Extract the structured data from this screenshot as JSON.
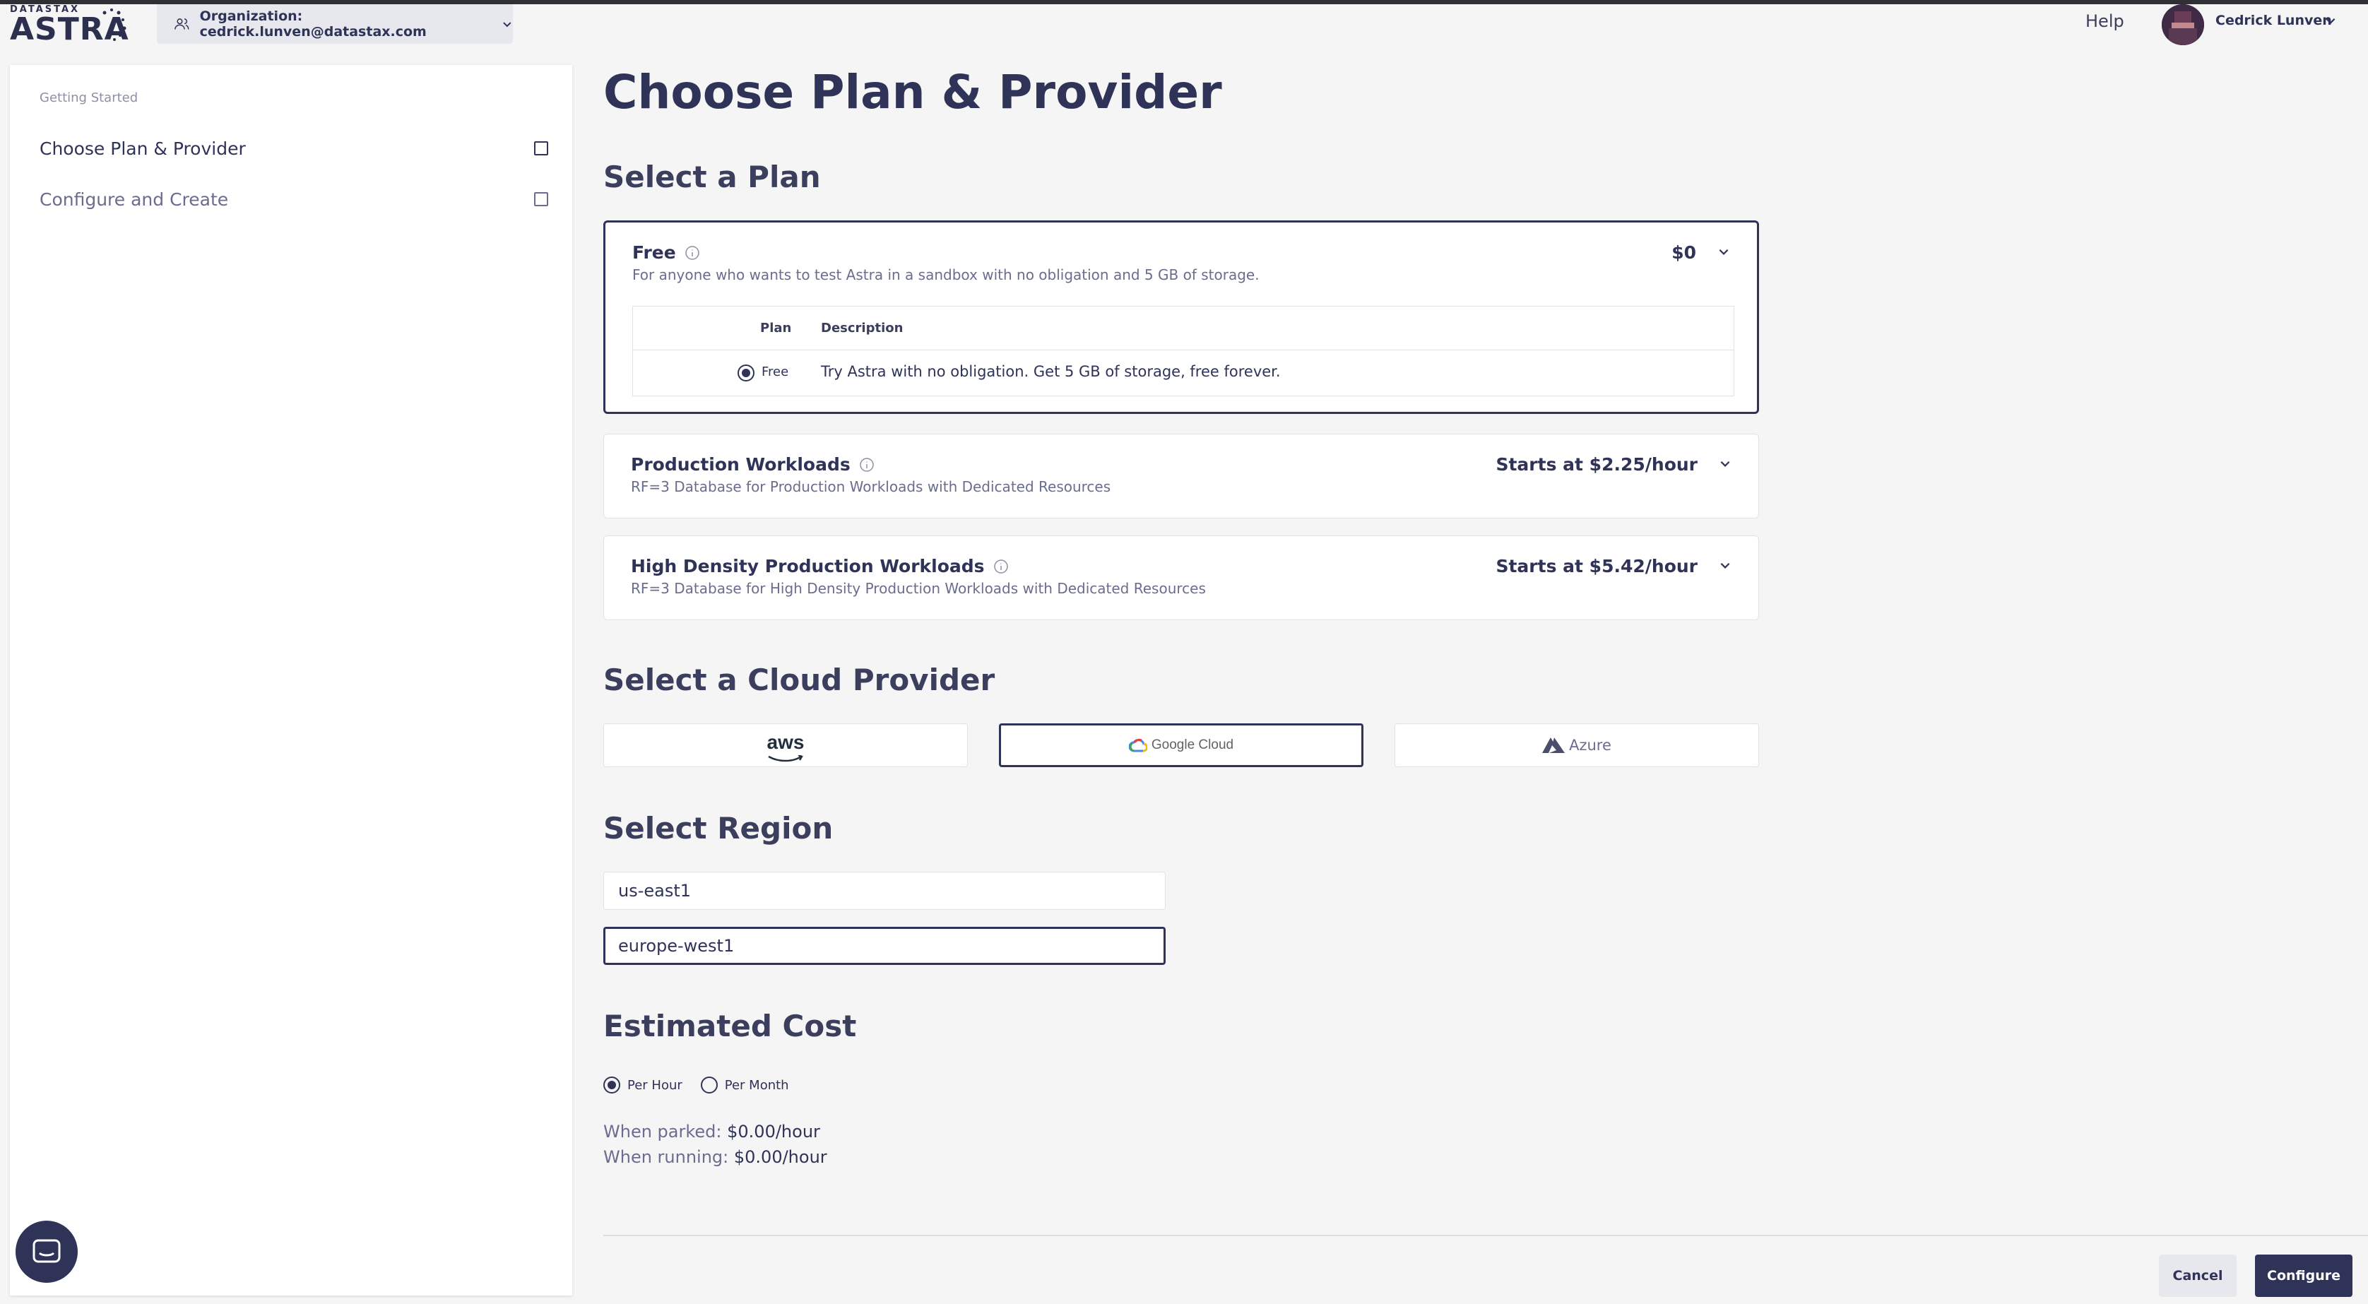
{
  "header": {
    "logo_small": "DATASTAX",
    "logo_big": "ASTRA",
    "org_label": "Organization: cedrick.lunven@datastax.com",
    "help": "Help",
    "user_name": "Cedrick Lunven"
  },
  "sidebar": {
    "section": "Getting Started",
    "items": [
      {
        "label": "Choose Plan & Provider"
      },
      {
        "label": "Configure and Create"
      }
    ]
  },
  "main": {
    "title": "Choose Plan & Provider",
    "select_plan_heading": "Select a Plan",
    "plans": [
      {
        "name": "Free",
        "description": "For anyone who wants to test Astra in a sandbox with no obligation and 5 GB of storage.",
        "price": "$0",
        "table": {
          "headers": [
            "Plan",
            "Description"
          ],
          "rows": [
            {
              "plan": "Free",
              "description": "Try Astra with no obligation. Get 5 GB of storage, free forever."
            }
          ]
        }
      },
      {
        "name": "Production Workloads",
        "description": "RF=3 Database for Production Workloads with Dedicated Resources",
        "price": "Starts at $2.25/hour"
      },
      {
        "name": "High Density Production Workloads",
        "description": "RF=3 Database for High Density Production Workloads with Dedicated Resources",
        "price": "Starts at $5.42/hour"
      }
    ],
    "provider_heading": "Select a Cloud Provider",
    "providers": {
      "aws": "aws",
      "gcp": "Google Cloud",
      "azure": "Azure",
      "selected": "Google Cloud"
    },
    "region_heading": "Select Region",
    "regions": [
      "us-east1",
      "europe-west1"
    ],
    "cost_heading": "Estimated Cost",
    "cost_options": [
      "Per Hour",
      "Per Month"
    ],
    "cost_selected": "Per Hour",
    "parked_label": "When parked:",
    "parked_value": "$0.00/hour",
    "running_label": "When running:",
    "running_value": "$0.00/hour"
  },
  "footer": {
    "cancel": "Cancel",
    "configure": "Configure"
  },
  "colors": {
    "primary": "#2f3358",
    "background": "#f5f5f5"
  }
}
